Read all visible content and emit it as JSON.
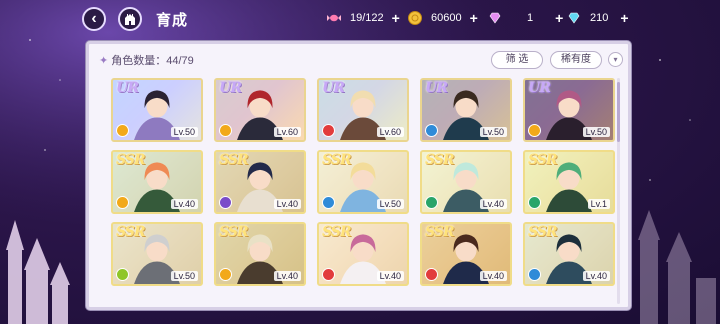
{
  "header": {
    "title": "育成",
    "back_icon": "back-arrow-icon",
    "home_icon": "castle-home-icon"
  },
  "resources": [
    {
      "name": "candy",
      "icon": "candy-icon",
      "value": "19/122"
    },
    {
      "name": "coin",
      "icon": "coin-icon",
      "value": "60600"
    },
    {
      "name": "gem-pink",
      "icon": "pink-gem-icon",
      "value": "1"
    },
    {
      "name": "gem-blue",
      "icon": "blue-diamond-icon",
      "value": "210"
    }
  ],
  "panel": {
    "count_label": "角色数量：44/79",
    "filter_label": "筛 选",
    "rarity_label": "稀有度",
    "sort_icon": "chevron-down-icon"
  },
  "cards": [
    {
      "rarity": "UR",
      "level": "Lv.50",
      "attr_color": "#f2a91a",
      "hair": "#2b2233",
      "outfit": "#8e7ac0",
      "bg": "#cfe2ff"
    },
    {
      "rarity": "UR",
      "level": "Lv.60",
      "attr_color": "#f2a91a",
      "hair": "#b0262c",
      "outfit": "#2a2a3a",
      "bg": "#f5d0a8"
    },
    {
      "rarity": "UR",
      "level": "Lv.60",
      "attr_color": "#e23c3c",
      "hair": "#f1ddb0",
      "outfit": "#6b4a3a",
      "bg": "#dff0d0"
    },
    {
      "rarity": "UR",
      "level": "Lv.50",
      "attr_color": "#2f8bd8",
      "hair": "#3a2a20",
      "outfit": "#1f3b4d",
      "bg": "#b7a27a"
    },
    {
      "rarity": "UR",
      "level": "Lv.50",
      "attr_color": "#f2a91a",
      "hair": "#b05a86",
      "outfit": "#2a1f2d",
      "bg": "#5a2c3a"
    },
    {
      "rarity": "SSR",
      "level": "Lv.40",
      "attr_color": "#f2a91a",
      "hair": "#ef8a54",
      "outfit": "#355a3a",
      "bg": "#bfe1ef"
    },
    {
      "rarity": "SSR",
      "level": "Lv.40",
      "attr_color": "#7a4cc9",
      "hair": "#232a4a",
      "outfit": "#e8dfd0",
      "bg": "#c8c2b8"
    },
    {
      "rarity": "SSR",
      "level": "Lv.50",
      "attr_color": "#2f8bd8",
      "hair": "#f3dc9a",
      "outfit": "#7fb4e0",
      "bg": "#e9eef6"
    },
    {
      "rarity": "SSR",
      "level": "Lv.40",
      "attr_color": "#2aa56a",
      "hair": "#bfe9dc",
      "outfit": "#3c5c64",
      "bg": "#e8f5f0"
    },
    {
      "rarity": "SSR",
      "level": "Lv.1",
      "attr_color": "#2aa56a",
      "hair": "#4fae7a",
      "outfit": "#2d4b38",
      "bg": "#e3f2c8"
    },
    {
      "rarity": "SSR",
      "level": "Lv.50",
      "attr_color": "#8fc628",
      "hair": "#cfcfcf",
      "outfit": "#6c6f76",
      "bg": "#d7dbe2"
    },
    {
      "rarity": "SSR",
      "level": "Lv.40",
      "attr_color": "#f2a91a",
      "hair": "#e9e1c6",
      "outfit": "#4a3c2e",
      "bg": "#c7c1a6"
    },
    {
      "rarity": "SSR",
      "level": "Lv.40",
      "attr_color": "#e23c3c",
      "hair": "#c86a9a",
      "outfit": "#f4f0f2",
      "bg": "#f1e3ea"
    },
    {
      "rarity": "SSR",
      "level": "Lv.40",
      "attr_color": "#e23c3c",
      "hair": "#4a2a1e",
      "outfit": "#1f2a4a",
      "bg": "#d8b58a"
    },
    {
      "rarity": "SSR",
      "level": "Lv.40",
      "attr_color": "#2f8bd8",
      "hair": "#1d2f3b",
      "outfit": "#2e4c5e",
      "bg": "#cfe2e9"
    }
  ]
}
